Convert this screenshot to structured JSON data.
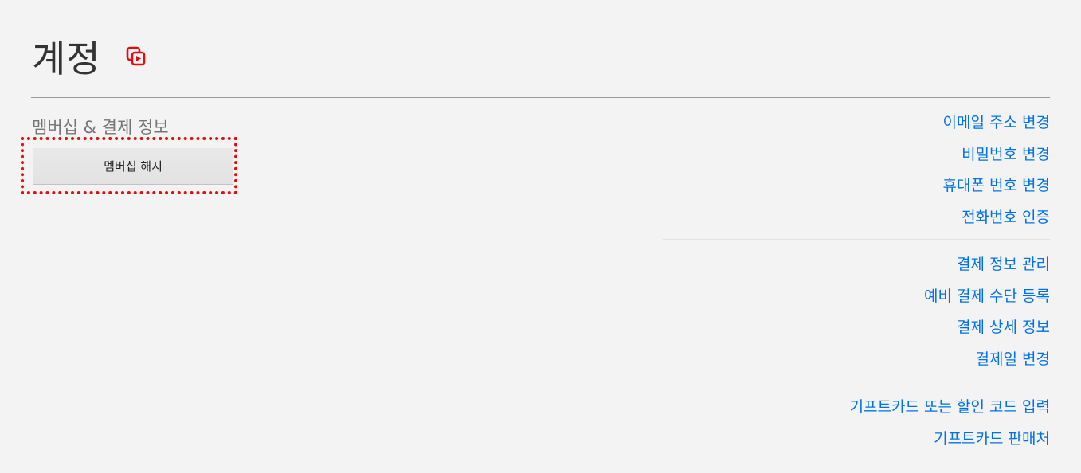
{
  "header": {
    "title": "계정",
    "icon": "membership-icon",
    "icon_color": "#e50914"
  },
  "membership": {
    "section_label": "멤버십 & 결제 정보",
    "cancel_button": "멤버십 해지",
    "highlight_color": "#e10e0e"
  },
  "links": {
    "group1": [
      "이메일 주소 변경",
      "비밀번호 변경",
      "휴대폰 번호 변경",
      "전화번호 인증"
    ],
    "group2": [
      "결제 정보 관리",
      "예비 결제 수단 등록",
      "결제 상세 정보",
      "결제일 변경"
    ],
    "group3": [
      "기프트카드 또는 할인 코드 입력",
      "기프트카드 판매처"
    ],
    "color": "#0071eb"
  }
}
